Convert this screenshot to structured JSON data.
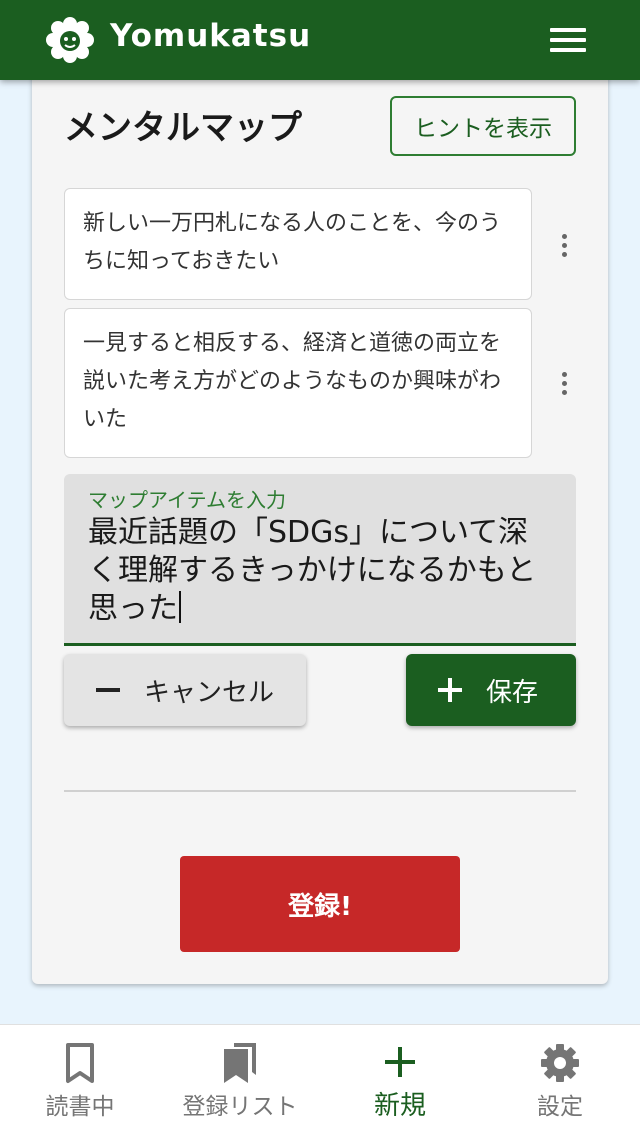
{
  "app": {
    "title": "Yomukatsu",
    "brand_color": "#1b5e20",
    "logo_icon": "sheep-logo-icon",
    "menu_icon": "hamburger-menu-icon"
  },
  "mental_map": {
    "title": "メンタルマップ",
    "hint_button": "ヒントを表示",
    "items": [
      {
        "text": "新しい一万円札になる人のことを、今のうちに知っておきたい"
      },
      {
        "text": "一見すると相反する、経済と道徳の両立を説いた考え方がどのようなものか興味がわいた"
      }
    ],
    "input": {
      "label": "マップアイテムを入力",
      "value": "最近話題の「SDGs」について深く理解するきっかけになるかもと思った"
    },
    "cancel_button": "キャンセル",
    "save_button": "保存",
    "register_button": "登録!",
    "register_color": "#c62828"
  },
  "bottom_nav": {
    "items": [
      {
        "label": "読書中",
        "icon": "bookmark-icon",
        "active": false
      },
      {
        "label": "登録リスト",
        "icon": "bookmarks-icon",
        "active": false
      },
      {
        "label": "新規",
        "icon": "plus-icon",
        "active": true
      },
      {
        "label": "設定",
        "icon": "gear-icon",
        "active": false
      }
    ]
  }
}
